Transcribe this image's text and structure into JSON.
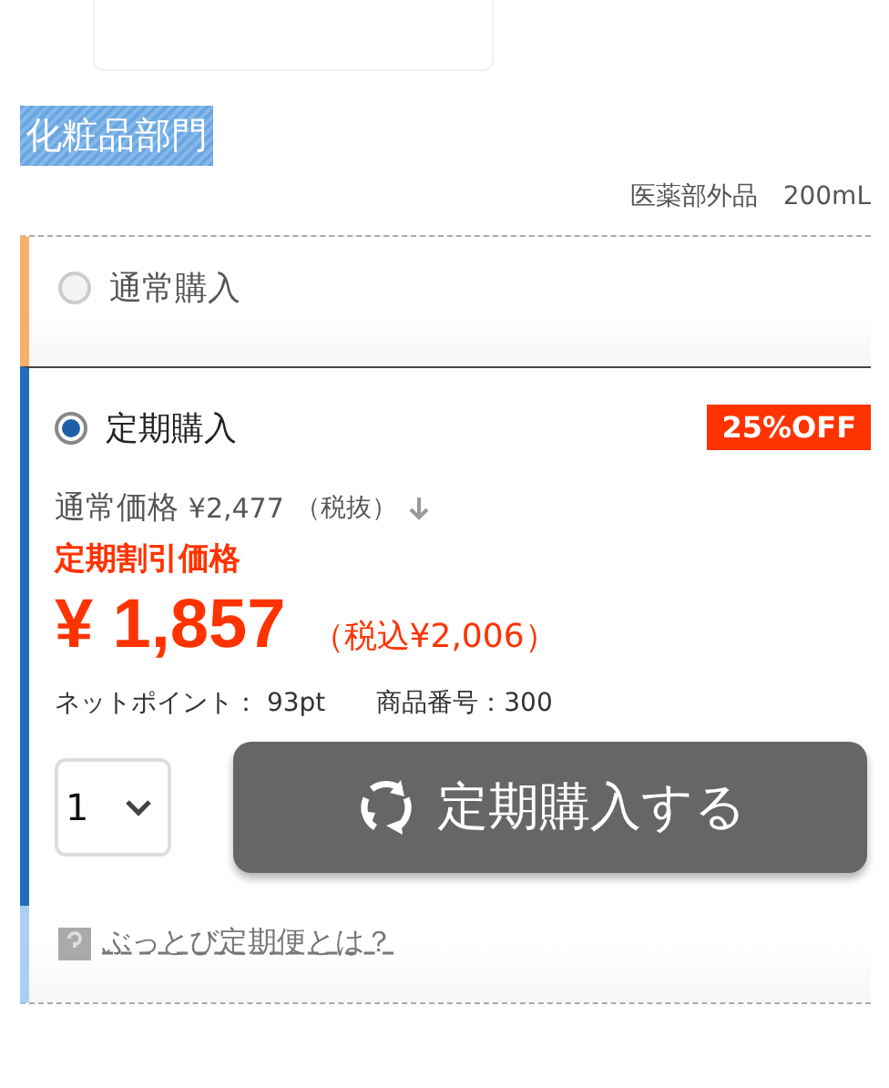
{
  "category_tag": "化粧品部門",
  "spec": "医薬部外品　200mL",
  "options": [
    {
      "label": "通常購入",
      "selected": false
    },
    {
      "label": "定期購入",
      "selected": true,
      "badge": "25%OFF"
    }
  ],
  "regular_price": {
    "label": "通常価格",
    "price": "¥2,477",
    "tax_note": "（税抜）"
  },
  "discount_label": "定期割引価格",
  "discount_price": {
    "amount": "¥ 1,857",
    "tax_included": "（税込¥2,006）"
  },
  "points": {
    "label": "ネットポイント：",
    "value": "93pt"
  },
  "product_no": {
    "label": "商品番号：",
    "value": "300"
  },
  "quantity": "1",
  "subscribe_button": "定期購入する",
  "help_link": "ぶっとび定期便とは？"
}
